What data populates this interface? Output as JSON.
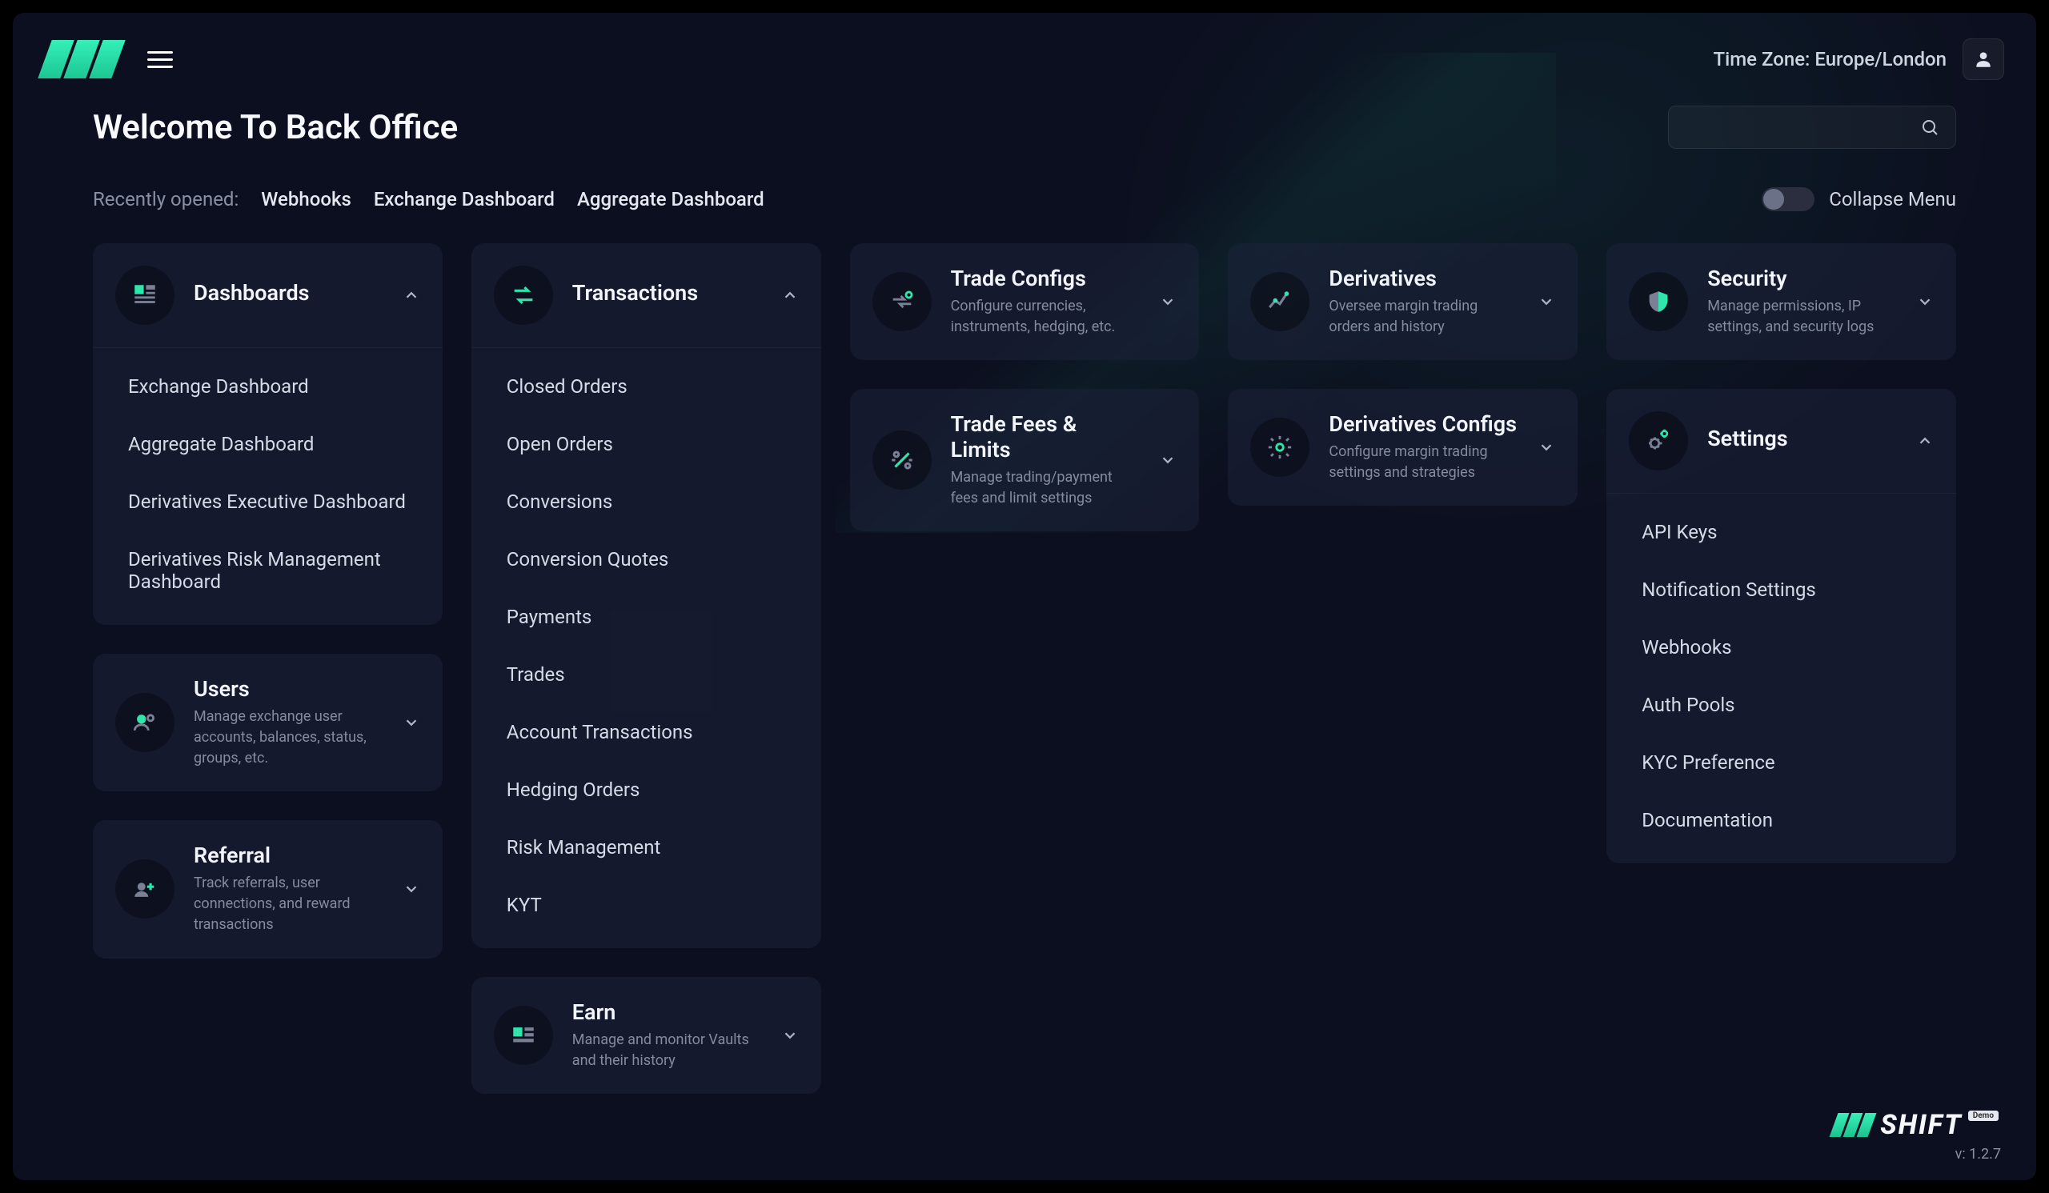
{
  "topbar": {
    "timezone": "Time Zone: Europe/London"
  },
  "heading": "Welcome To Back Office",
  "recent": {
    "label": "Recently opened:",
    "items": [
      "Webhooks",
      "Exchange Dashboard",
      "Aggregate Dashboard"
    ]
  },
  "collapse_label": "Collapse Menu",
  "columns": {
    "dashboards": {
      "title": "Dashboards",
      "expanded": true,
      "items": [
        "Exchange Dashboard",
        "Aggregate Dashboard",
        "Derivatives Executive Dashboard",
        "Derivatives Risk Management Dashboard"
      ]
    },
    "users": {
      "title": "Users",
      "sub": "Manage exchange user accounts, balances, status, groups, etc.",
      "expanded": false
    },
    "referral": {
      "title": "Referral",
      "sub": "Track referrals, user connections, and reward transactions",
      "expanded": false
    },
    "transactions": {
      "title": "Transactions",
      "expanded": true,
      "items": [
        "Closed Orders",
        "Open Orders",
        "Conversions",
        "Conversion Quotes",
        "Payments",
        "Trades",
        "Account Transactions",
        "Hedging Orders",
        "Risk Management",
        "KYT"
      ]
    },
    "earn": {
      "title": "Earn",
      "sub": "Manage and monitor Vaults and their history",
      "expanded": false
    },
    "trade_configs": {
      "title": "Trade Configs",
      "sub": "Configure currencies, instruments, hedging, etc.",
      "expanded": false
    },
    "trade_fees": {
      "title": "Trade Fees & Limits",
      "sub": "Manage trading/payment fees and limit settings",
      "expanded": false
    },
    "derivatives": {
      "title": "Derivatives",
      "sub": "Oversee margin trading orders and history",
      "expanded": false
    },
    "derivatives_configs": {
      "title": "Derivatives Configs",
      "sub": "Configure margin trading settings and strategies",
      "expanded": false
    },
    "security": {
      "title": "Security",
      "sub": "Manage permissions, IP settings, and security logs",
      "expanded": false
    },
    "settings": {
      "title": "Settings",
      "expanded": true,
      "items": [
        "API Keys",
        "Notification Settings",
        "Webhooks",
        "Auth Pools",
        "KYC Preference",
        "Documentation"
      ]
    }
  },
  "footer": {
    "brand": "SHIFT",
    "badge": "Demo",
    "version": "v: 1.2.7"
  }
}
